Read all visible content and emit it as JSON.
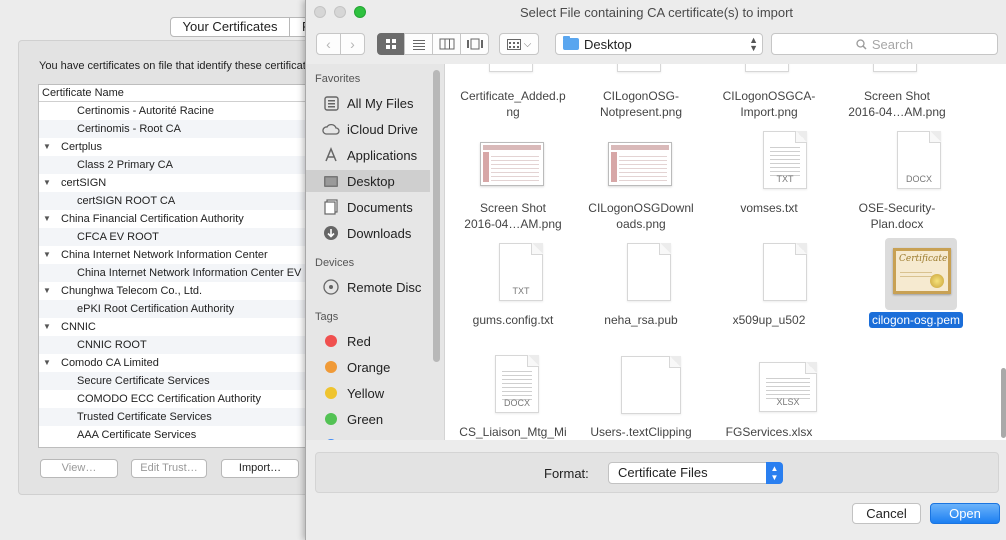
{
  "background_window": {
    "tabs": [
      "Your Certificates",
      "P"
    ],
    "description": "You have certificates on file that identify these certificate authorities",
    "tree_header": "Certificate Name",
    "rows": [
      {
        "kind": "child",
        "label": "Certinomis - Autorité Racine"
      },
      {
        "kind": "child",
        "label": "Certinomis - Root CA"
      },
      {
        "kind": "cat",
        "label": "Certplus"
      },
      {
        "kind": "child",
        "label": "Class 2 Primary CA"
      },
      {
        "kind": "cat",
        "label": "certSIGN"
      },
      {
        "kind": "child",
        "label": "certSIGN ROOT CA"
      },
      {
        "kind": "cat",
        "label": "China Financial Certification Authority"
      },
      {
        "kind": "child",
        "label": "CFCA EV ROOT"
      },
      {
        "kind": "cat",
        "label": "China Internet Network Information Center"
      },
      {
        "kind": "child",
        "label": "China Internet Network Information Center EV"
      },
      {
        "kind": "cat",
        "label": "Chunghwa Telecom Co., Ltd."
      },
      {
        "kind": "child",
        "label": "ePKI Root Certification Authority"
      },
      {
        "kind": "cat",
        "label": "CNNIC"
      },
      {
        "kind": "child",
        "label": "CNNIC ROOT"
      },
      {
        "kind": "cat",
        "label": "Comodo CA Limited"
      },
      {
        "kind": "child",
        "label": "Secure Certificate Services"
      },
      {
        "kind": "child",
        "label": "COMODO ECC Certification Authority"
      },
      {
        "kind": "child",
        "label": "Trusted Certificate Services"
      },
      {
        "kind": "child",
        "label": "AAA Certificate Services"
      }
    ],
    "buttons": {
      "view": "View…",
      "edit_trust": "Edit Trust…",
      "import": "Import…"
    }
  },
  "dialog": {
    "title": "Select File containing CA certificate(s) to import",
    "location": "Desktop",
    "search_placeholder": "Search",
    "sidebar": {
      "favorites_heading": "Favorites",
      "favorites": [
        {
          "label": "All My Files",
          "icon": "all-files-icon"
        },
        {
          "label": "iCloud Drive",
          "icon": "cloud-icon"
        },
        {
          "label": "Applications",
          "icon": "applications-icon"
        },
        {
          "label": "Desktop",
          "icon": "desktop-icon",
          "selected": true
        },
        {
          "label": "Documents",
          "icon": "documents-icon"
        },
        {
          "label": "Downloads",
          "icon": "downloads-icon"
        }
      ],
      "devices_heading": "Devices",
      "devices": [
        {
          "label": "Remote Disc",
          "icon": "disc-icon"
        }
      ],
      "tags_heading": "Tags",
      "tags": [
        {
          "label": "Red",
          "color": "#f0504f"
        },
        {
          "label": "Orange",
          "color": "#f09a37"
        },
        {
          "label": "Yellow",
          "color": "#efc42f"
        },
        {
          "label": "Green",
          "color": "#53c254"
        }
      ]
    },
    "files": [
      {
        "label1": "Certificate_Added.p",
        "label2": "ng",
        "kind": "partial"
      },
      {
        "label1": "CILogonOSG-",
        "label2": "Notpresent.png",
        "kind": "partial"
      },
      {
        "label1": "CILogonOSGCA-",
        "label2": "Import.png",
        "kind": "partial"
      },
      {
        "label1": "Screen Shot",
        "label2": "2016-04…AM.png",
        "kind": "partial"
      },
      {
        "label1": "Screen Shot",
        "label2": "2016-04…AM.png",
        "kind": "screenshot"
      },
      {
        "label1": "CILogonOSGDownl",
        "label2": "oads.png",
        "kind": "screenshot"
      },
      {
        "label1": "vomses.txt",
        "label2": "",
        "kind": "doc",
        "ext": "TXT"
      },
      {
        "label1": "OSE-Security-",
        "label2": "Plan.docx",
        "kind": "doc",
        "ext": "DOCX"
      },
      {
        "label1": "gums.config.txt",
        "label2": "",
        "kind": "doc",
        "ext": "TXT"
      },
      {
        "label1": "neha_rsa.pub",
        "label2": "",
        "kind": "blank"
      },
      {
        "label1": "x509up_u502",
        "label2": "",
        "kind": "blank"
      },
      {
        "label1": "cilogon-osg.pem",
        "label2": "",
        "kind": "cert",
        "selected": true
      },
      {
        "label1": "CS_Liaison_Mtg_Mi",
        "label2": "",
        "kind": "doc",
        "ext": "DOCX"
      },
      {
        "label1": "Users-.textClipping",
        "label2": "",
        "kind": "clip"
      },
      {
        "label1": "FGServices.xlsx",
        "label2": "",
        "kind": "doc",
        "ext": "XLSX"
      }
    ],
    "cert_icon_text": "Certificate",
    "format_label": "Format:",
    "format_value": "Certificate Files",
    "cancel_label": "Cancel",
    "open_label": "Open"
  }
}
